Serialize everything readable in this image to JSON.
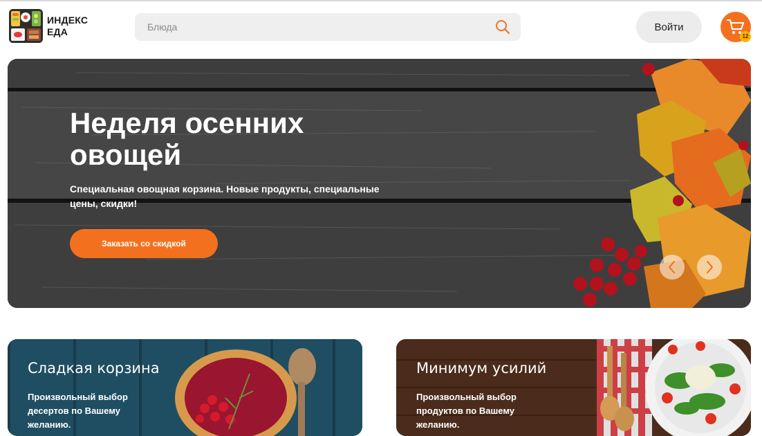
{
  "header": {
    "logo": {
      "line1": "ИНДЕКС",
      "line2": "ЕДА"
    },
    "search": {
      "placeholder": "Блюда",
      "value": ""
    },
    "login_label": "Войти",
    "cart": {
      "count": "12"
    }
  },
  "hero": {
    "title": "Неделя осенних овощей",
    "subtitle": "Специальная овощная корзина. Новые продукты, специальные цены, скидки!",
    "button_label": "Заказать со скидкой"
  },
  "cards": [
    {
      "title": "Сладкая корзина",
      "text": "Произвольный выбор десертов по Вашему желанию."
    },
    {
      "title": "Минимум усилий",
      "text": "Произвольный выбор продуктов по Вашему желанию."
    }
  ],
  "colors": {
    "accent": "#f3711e",
    "badge": "#ffb000",
    "search_bg": "#efefef",
    "login_bg": "#ececec"
  },
  "icons": [
    "logo-bento-icon",
    "search-icon",
    "cart-icon",
    "chevron-left-icon",
    "chevron-right-icon"
  ]
}
